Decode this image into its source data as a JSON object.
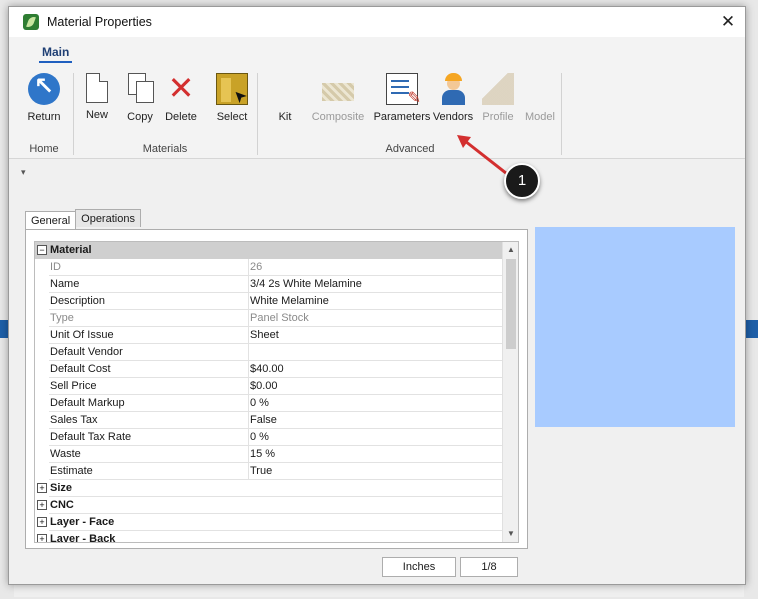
{
  "window": {
    "title": "Material Properties"
  },
  "ribbon": {
    "tab": "Main",
    "groups": {
      "home": {
        "label": "Home",
        "return_label": "Return"
      },
      "materials": {
        "label": "Materials",
        "new_label": "New",
        "copy_label": "Copy",
        "delete_label": "Delete",
        "select_label": "Select"
      },
      "advanced": {
        "label": "Advanced",
        "kit_label": "Kit",
        "composite_label": "Composite",
        "parameters_label": "Parameters",
        "vendors_label": "Vendors",
        "profile_label": "Profile",
        "model_label": "Model"
      }
    }
  },
  "annotation": {
    "number": "1",
    "color": "#d32f2f"
  },
  "tabs": {
    "general": "General",
    "operations": "Operations"
  },
  "grid": {
    "category": "Material",
    "rows": [
      {
        "key": "ID",
        "value": "26"
      },
      {
        "key": "Name",
        "value": "3/4 2s White Melamine"
      },
      {
        "key": "Description",
        "value": "White Melamine"
      },
      {
        "key": "Type",
        "value": "Panel Stock"
      },
      {
        "key": "Unit Of Issue",
        "value": "Sheet"
      },
      {
        "key": "Default Vendor",
        "value": ""
      },
      {
        "key": "Default Cost",
        "value": "$40.00"
      },
      {
        "key": "Sell Price",
        "value": "$0.00"
      },
      {
        "key": "Default Markup",
        "value": "0 %"
      },
      {
        "key": "Sales Tax",
        "value": "False"
      },
      {
        "key": "Default Tax Rate",
        "value": "0 %"
      },
      {
        "key": "Waste",
        "value": "15 %"
      },
      {
        "key": "Estimate",
        "value": "True"
      }
    ],
    "collapsed_categories": [
      "Size",
      "CNC",
      "Layer - Face",
      "Layer - Back"
    ]
  },
  "preview": {
    "color": "#a8cbff"
  },
  "status": {
    "units": "Inches",
    "precision": "1/8"
  }
}
